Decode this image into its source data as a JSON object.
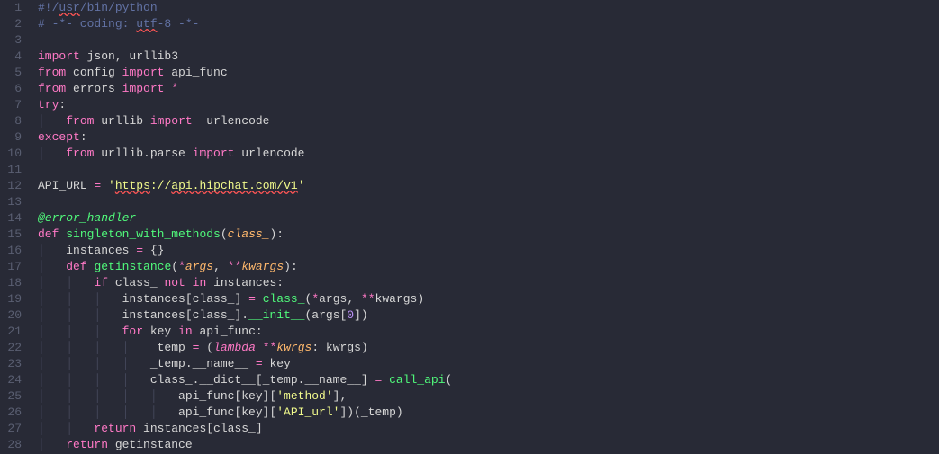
{
  "lines": [
    {
      "n": 1,
      "tokens": [
        {
          "t": "#!/",
          "c": "cm"
        },
        {
          "t": "usr",
          "c": "cm sq"
        },
        {
          "t": "/bin/python",
          "c": "cm"
        }
      ]
    },
    {
      "n": 2,
      "tokens": [
        {
          "t": "# -*- coding: ",
          "c": "cm"
        },
        {
          "t": "utf",
          "c": "cm sq"
        },
        {
          "t": "-8 -*-",
          "c": "cm"
        }
      ]
    },
    {
      "n": 3,
      "tokens": []
    },
    {
      "n": 4,
      "tokens": [
        {
          "t": "import",
          "c": "k"
        },
        {
          "t": " json, urllib3",
          "c": "id"
        }
      ]
    },
    {
      "n": 5,
      "tokens": [
        {
          "t": "from",
          "c": "k"
        },
        {
          "t": " config ",
          "c": "id"
        },
        {
          "t": "import",
          "c": "k"
        },
        {
          "t": " api_func",
          "c": "id"
        }
      ]
    },
    {
      "n": 6,
      "tokens": [
        {
          "t": "from",
          "c": "k"
        },
        {
          "t": " errors ",
          "c": "id"
        },
        {
          "t": "import",
          "c": "k"
        },
        {
          "t": " ",
          "c": "id"
        },
        {
          "t": "*",
          "c": "op"
        }
      ]
    },
    {
      "n": 7,
      "tokens": [
        {
          "t": "try",
          "c": "k"
        },
        {
          "t": ":",
          "c": "id"
        }
      ]
    },
    {
      "n": 8,
      "tokens": [
        {
          "t": "│   ",
          "c": "guide"
        },
        {
          "t": "from",
          "c": "k"
        },
        {
          "t": " urllib ",
          "c": "id"
        },
        {
          "t": "import",
          "c": "k"
        },
        {
          "t": "  urlencode",
          "c": "id"
        }
      ]
    },
    {
      "n": 9,
      "tokens": [
        {
          "t": "except",
          "c": "k"
        },
        {
          "t": ":",
          "c": "id"
        }
      ]
    },
    {
      "n": 10,
      "tokens": [
        {
          "t": "│   ",
          "c": "guide"
        },
        {
          "t": "from",
          "c": "k"
        },
        {
          "t": " urllib.parse ",
          "c": "id"
        },
        {
          "t": "import",
          "c": "k"
        },
        {
          "t": " urlencode",
          "c": "id"
        }
      ]
    },
    {
      "n": 11,
      "tokens": []
    },
    {
      "n": 12,
      "tokens": [
        {
          "t": "API_URL ",
          "c": "id"
        },
        {
          "t": "=",
          "c": "op"
        },
        {
          "t": " ",
          "c": "id"
        },
        {
          "t": "'",
          "c": "str"
        },
        {
          "t": "https",
          "c": "str sq"
        },
        {
          "t": "://",
          "c": "str"
        },
        {
          "t": "api.hipchat.com/v1",
          "c": "str sq"
        },
        {
          "t": "'",
          "c": "str"
        }
      ]
    },
    {
      "n": 13,
      "tokens": []
    },
    {
      "n": 14,
      "tokens": [
        {
          "t": "@error_handler",
          "c": "dec"
        }
      ]
    },
    {
      "n": 15,
      "tokens": [
        {
          "t": "def",
          "c": "k"
        },
        {
          "t": " ",
          "c": "id"
        },
        {
          "t": "singleton_with_methods",
          "c": "fn"
        },
        {
          "t": "(",
          "c": "id"
        },
        {
          "t": "class_",
          "c": "prm"
        },
        {
          "t": "):",
          "c": "id"
        }
      ]
    },
    {
      "n": 16,
      "tokens": [
        {
          "t": "│   ",
          "c": "guide"
        },
        {
          "t": "instances ",
          "c": "id"
        },
        {
          "t": "=",
          "c": "op"
        },
        {
          "t": " {}",
          "c": "id"
        }
      ]
    },
    {
      "n": 17,
      "tokens": [
        {
          "t": "│   ",
          "c": "guide"
        },
        {
          "t": "def",
          "c": "k"
        },
        {
          "t": " ",
          "c": "id"
        },
        {
          "t": "getinstance",
          "c": "fn"
        },
        {
          "t": "(",
          "c": "id"
        },
        {
          "t": "*",
          "c": "op"
        },
        {
          "t": "args",
          "c": "prm"
        },
        {
          "t": ", ",
          "c": "id"
        },
        {
          "t": "**",
          "c": "op"
        },
        {
          "t": "kwargs",
          "c": "prm"
        },
        {
          "t": "):",
          "c": "id"
        }
      ]
    },
    {
      "n": 18,
      "tokens": [
        {
          "t": "│   │   ",
          "c": "guide"
        },
        {
          "t": "if",
          "c": "k"
        },
        {
          "t": " class_ ",
          "c": "id"
        },
        {
          "t": "not",
          "c": "k"
        },
        {
          "t": " ",
          "c": "id"
        },
        {
          "t": "in",
          "c": "k"
        },
        {
          "t": " instances:",
          "c": "id"
        }
      ]
    },
    {
      "n": 19,
      "tokens": [
        {
          "t": "│   │   │   ",
          "c": "guide"
        },
        {
          "t": "instances[class_] ",
          "c": "id"
        },
        {
          "t": "=",
          "c": "op"
        },
        {
          "t": " ",
          "c": "id"
        },
        {
          "t": "class_",
          "c": "fn"
        },
        {
          "t": "(",
          "c": "id"
        },
        {
          "t": "*",
          "c": "op"
        },
        {
          "t": "args, ",
          "c": "id"
        },
        {
          "t": "**",
          "c": "op"
        },
        {
          "t": "kwargs)",
          "c": "id"
        }
      ]
    },
    {
      "n": 20,
      "tokens": [
        {
          "t": "│   │   │   ",
          "c": "guide"
        },
        {
          "t": "instances[class_].",
          "c": "id"
        },
        {
          "t": "__init__",
          "c": "fn"
        },
        {
          "t": "(args[",
          "c": "id"
        },
        {
          "t": "0",
          "c": "num"
        },
        {
          "t": "])",
          "c": "id"
        }
      ]
    },
    {
      "n": 21,
      "tokens": [
        {
          "t": "│   │   │   ",
          "c": "guide"
        },
        {
          "t": "for",
          "c": "k"
        },
        {
          "t": " key ",
          "c": "id"
        },
        {
          "t": "in",
          "c": "k"
        },
        {
          "t": " api_func:",
          "c": "id"
        }
      ]
    },
    {
      "n": 22,
      "tokens": [
        {
          "t": "│   │   │   │   ",
          "c": "guide"
        },
        {
          "t": "_temp ",
          "c": "id"
        },
        {
          "t": "=",
          "c": "op"
        },
        {
          "t": " (",
          "c": "id"
        },
        {
          "t": "lambda",
          "c": "kf"
        },
        {
          "t": " ",
          "c": "id"
        },
        {
          "t": "**",
          "c": "op"
        },
        {
          "t": "kwrgs",
          "c": "prm"
        },
        {
          "t": ": kwrgs)",
          "c": "id"
        }
      ]
    },
    {
      "n": 23,
      "tokens": [
        {
          "t": "│   │   │   │   ",
          "c": "guide"
        },
        {
          "t": "_temp.__name__ ",
          "c": "id"
        },
        {
          "t": "=",
          "c": "op"
        },
        {
          "t": " key",
          "c": "id"
        }
      ]
    },
    {
      "n": 24,
      "tokens": [
        {
          "t": "│   │   │   │   ",
          "c": "guide"
        },
        {
          "t": "class_.__dict__[_temp.__name__] ",
          "c": "id"
        },
        {
          "t": "=",
          "c": "op"
        },
        {
          "t": " ",
          "c": "id"
        },
        {
          "t": "call_api",
          "c": "fn"
        },
        {
          "t": "(",
          "c": "id"
        }
      ]
    },
    {
      "n": 25,
      "tokens": [
        {
          "t": "│   │   │   │   │   ",
          "c": "guide"
        },
        {
          "t": "api_func[key][",
          "c": "id"
        },
        {
          "t": "'method'",
          "c": "str"
        },
        {
          "t": "],",
          "c": "id"
        }
      ]
    },
    {
      "n": 26,
      "tokens": [
        {
          "t": "│   │   │   │   │   ",
          "c": "guide"
        },
        {
          "t": "api_func[key][",
          "c": "id"
        },
        {
          "t": "'API_url'",
          "c": "str"
        },
        {
          "t": "])(_temp)",
          "c": "id"
        }
      ]
    },
    {
      "n": 27,
      "tokens": [
        {
          "t": "│   │   ",
          "c": "guide"
        },
        {
          "t": "return",
          "c": "k"
        },
        {
          "t": " instances[class_]",
          "c": "id"
        }
      ]
    },
    {
      "n": 28,
      "tokens": [
        {
          "t": "│   ",
          "c": "guide"
        },
        {
          "t": "return",
          "c": "k"
        },
        {
          "t": " getinstance",
          "c": "id"
        }
      ]
    }
  ]
}
